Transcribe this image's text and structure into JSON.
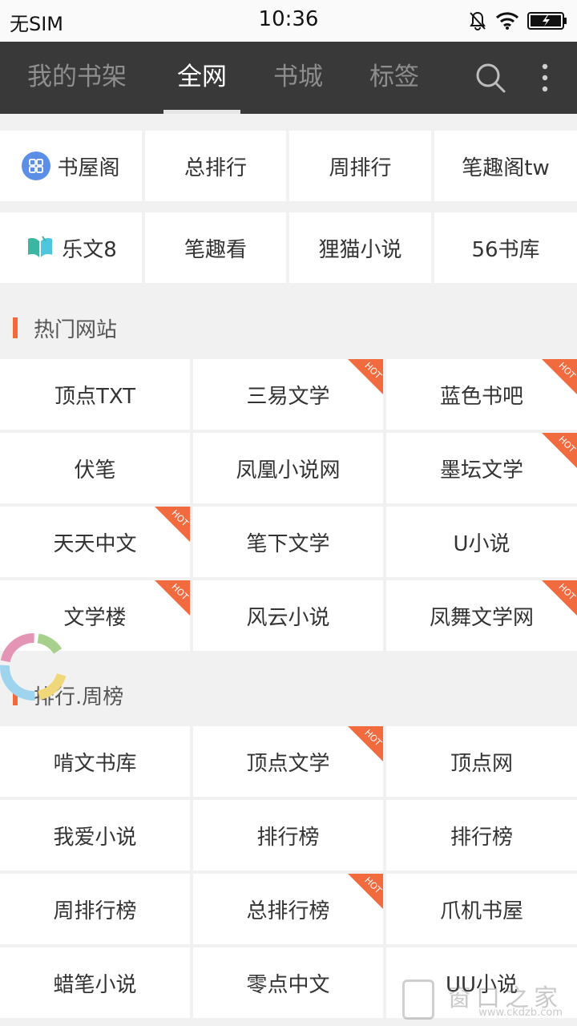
{
  "status_bar": {
    "carrier": "无SIM",
    "time": "10:36",
    "icons": [
      "bell-muted-icon",
      "wifi-icon",
      "battery-charging-icon"
    ]
  },
  "nav": {
    "tabs": [
      {
        "label": "我的书架",
        "active": false
      },
      {
        "label": "全网",
        "active": true
      },
      {
        "label": "书城",
        "active": false
      },
      {
        "label": "标签",
        "active": false
      }
    ],
    "icons": [
      "search-icon",
      "more-vertical-icon"
    ]
  },
  "quick_sites": [
    {
      "label": "书屋阁",
      "icon": "grid-logo-icon"
    },
    {
      "label": "总排行"
    },
    {
      "label": "周排行"
    },
    {
      "label": "笔趣阁tw"
    },
    {
      "label": "乐文8",
      "icon": "book-logo-icon"
    },
    {
      "label": "笔趣看"
    },
    {
      "label": "狸猫小说"
    },
    {
      "label": "56书库"
    }
  ],
  "hot_sites": {
    "title": "热门网站",
    "badge": "HOT",
    "items": [
      {
        "label": "顶点TXT",
        "hot": false
      },
      {
        "label": "三易文学",
        "hot": true
      },
      {
        "label": "蓝色书吧",
        "hot": true
      },
      {
        "label": "伏笔",
        "hot": false
      },
      {
        "label": "凤凰小说网",
        "hot": false
      },
      {
        "label": "墨坛文学",
        "hot": true
      },
      {
        "label": "天天中文",
        "hot": true
      },
      {
        "label": "笔下文学",
        "hot": false
      },
      {
        "label": "U小说",
        "hot": false
      },
      {
        "label": "文学楼",
        "hot": true
      },
      {
        "label": "风云小说",
        "hot": false
      },
      {
        "label": "凤舞文学网",
        "hot": true
      }
    ]
  },
  "rank_sites": {
    "title": "排行.周榜",
    "badge": "HOT",
    "items": [
      {
        "label": "啃文书库",
        "hot": false
      },
      {
        "label": "顶点文学",
        "hot": true
      },
      {
        "label": "顶点网",
        "hot": false
      },
      {
        "label": "我爱小说",
        "hot": false
      },
      {
        "label": "排行榜",
        "hot": false
      },
      {
        "label": "排行榜",
        "hot": false
      },
      {
        "label": "周排行榜",
        "hot": false
      },
      {
        "label": "总排行榜",
        "hot": true
      },
      {
        "label": "爪机书屋",
        "hot": false
      },
      {
        "label": "蜡笔小说",
        "hot": false
      },
      {
        "label": "零点中文",
        "hot": false
      },
      {
        "label": "UU小说",
        "hot": false
      }
    ]
  },
  "watermark": {
    "text": "窗口之家",
    "url": "www.ckdzb.com"
  },
  "colors": {
    "accent": "#f16a3e",
    "nav_bg": "#393939",
    "hot_badge": "#f26b3f"
  }
}
